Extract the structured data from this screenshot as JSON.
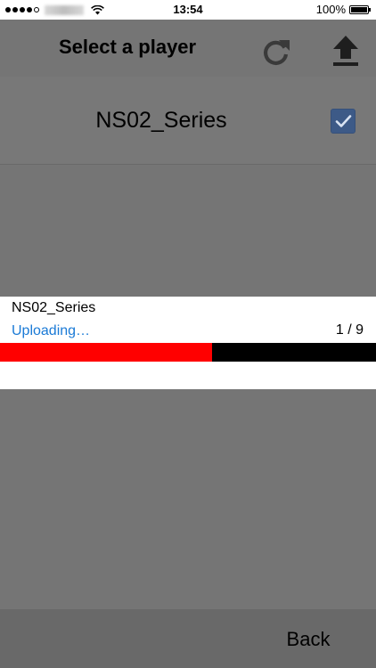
{
  "status_bar": {
    "time": "13:54",
    "battery": "100%",
    "signal_bars": 4,
    "signal_max": 5
  },
  "header": {
    "title": "Select a player",
    "refresh_icon": "refresh-icon",
    "upload_icon": "upload-icon"
  },
  "players": [
    {
      "name": "NS02_Series",
      "checked": true
    }
  ],
  "dialog": {
    "title": "NS02_Series",
    "status": "Uploading…",
    "progress_text": "1 / 9",
    "progress_fraction": 0.565
  },
  "footer": {
    "back_label": "Back"
  },
  "colors": {
    "background": "#757575",
    "footer": "#696969",
    "checkbox": "#3d5a87",
    "status_link": "#1a7ad6",
    "progress_fill": "#ff0000",
    "progress_track": "#000000"
  }
}
